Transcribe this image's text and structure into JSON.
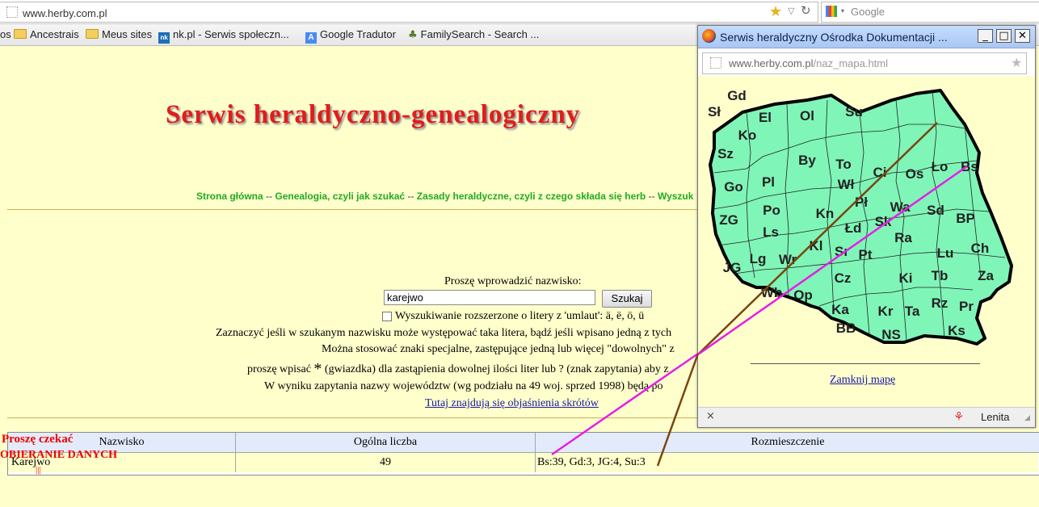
{
  "browser": {
    "url": "www.herby.com.pl",
    "search_placeholder": "Google",
    "bookmarks": [
      "os",
      "Ancestrais",
      "Meus sites",
      "nk.pl - Serwis społeczn...",
      "Google Tradutor",
      "FamilySearch - Search ..."
    ]
  },
  "page": {
    "title": "Serwis heraldyczno-genealogiczny",
    "nav": [
      "Strona główna",
      "Genealogia, czyli jak szukać",
      "Zasady heraldyczne, czyli z czego składa się herb",
      "Wyszuk"
    ],
    "nav_sep": "--",
    "search_label": "Proszę wprowadzić nazwisko:",
    "search_value": "karejwo",
    "search_button": "Szukaj",
    "umlaut_label": "Wyszukiwanie rozszerzone o litery z 'umlaut': ä, ë, ö, ü",
    "info_line1": "Zaznaczyć jeśli w szukanym nazwisku może występować taka litera, bądź jeśli wpisano jedną z tych",
    "info_line2": "Można stosować znaki specjalne, zastępujące jedną lub więcej \"dowolnych\" z",
    "info_line3_a": "proszę wpisać",
    "info_line3_star": "*",
    "info_line3_b": "(gwiazdka) dla zastąpienia dowolnej ilości liter lub ? (znak zapytania) aby z",
    "info_line4": "W wyniku zapytania nazwy województw (wg podziału na 49 woj. sprzed 1998) będą po",
    "abbrev_link": "Tutaj znajdują się objaśnienia skrótów"
  },
  "results": {
    "headers": [
      "Nazwisko",
      "Ogólna liczba",
      "Rozmieszczenie"
    ],
    "rows": [
      {
        "surname": "Karejwo",
        "count": "49",
        "distribution": "Bs:39, Gd:3, JG:4, Su:3"
      }
    ],
    "loading_line1": "Proszę czekać",
    "loading_line2": "OBIERANIE DANYCH",
    "loading_mark": "|||"
  },
  "popup": {
    "window_title": "Serwis heraldyczny Ośrodka Dokumentacji ...",
    "url_domain": "www.herby.com.pl",
    "url_path": "/naz_mapa.html",
    "close_map_link": "Zamknij mapę",
    "status_close": "×",
    "status_addon": "Lenita",
    "map_fill": "#80f5b8",
    "regions": [
      "Sł",
      "Gd",
      "El",
      "Ol",
      "Su",
      "Ko",
      "Sz",
      "By",
      "To",
      "Wł",
      "Ci",
      "Os",
      "Ło",
      "Bs",
      "Go",
      "Pl",
      "Pł",
      "Wa",
      "Sd",
      "ZG",
      "Po",
      "Kn",
      "Łd",
      "Sk",
      "BP",
      "Ls",
      "Ra",
      "Ch",
      "Kl",
      "Sr",
      "Pt",
      "Lu",
      "JG",
      "Lg",
      "Wr",
      "Cz",
      "Ki",
      "Tb",
      "Za",
      "Wb",
      "Op",
      "Ka",
      "Kr",
      "Ta",
      "Rz",
      "Pr",
      "BB",
      "NS",
      "Ks"
    ]
  },
  "colors": {
    "page_bg": "#ffffcc",
    "title_red": "#e31b1b",
    "nav_green": "#22aa22",
    "line_magenta": "#e61ee6",
    "line_brown": "#7a4510"
  }
}
